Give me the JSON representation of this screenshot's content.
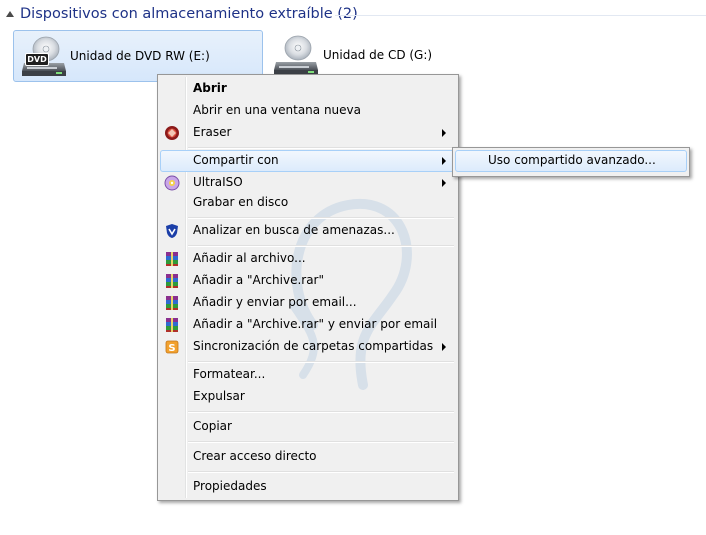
{
  "group": {
    "title": "Dispositivos con almacenamiento extraíble (2)"
  },
  "drives": [
    {
      "label": "Unidad de DVD RW (E:)",
      "icon": "dvd-drive-icon",
      "badge": "DVD",
      "selected": true
    },
    {
      "label": "Unidad de CD (G:)",
      "icon": "cd-drive-icon",
      "selected": false
    }
  ],
  "menu": {
    "items": [
      {
        "label": "Abrir",
        "bold": true
      },
      {
        "label": "Abrir en una ventana nueva"
      },
      {
        "label": "Eraser",
        "icon": "eraser-icon",
        "submenu": true
      },
      {
        "label": "Compartir con",
        "submenu": true,
        "highlighted": true
      },
      {
        "label": "UltraISO",
        "icon": "ultraiso-icon",
        "submenu": true
      },
      {
        "label": "Grabar en disco"
      },
      {
        "label": "Analizar en busca de amenazas...",
        "icon": "shield-icon"
      },
      {
        "label": "Añadir al archivo...",
        "icon": "winrar-icon"
      },
      {
        "label": "Añadir a \"Archive.rar\"",
        "icon": "winrar-icon"
      },
      {
        "label": "Añadir y enviar por email...",
        "icon": "winrar-icon"
      },
      {
        "label": "Añadir a \"Archive.rar\" y enviar por email",
        "icon": "winrar-icon"
      },
      {
        "label": "Sincronización de carpetas compartidas",
        "icon": "sync-icon",
        "submenu": true
      },
      {
        "label": "Formatear..."
      },
      {
        "label": "Expulsar"
      },
      {
        "label": "Copiar"
      },
      {
        "label": "Crear acceso directo"
      },
      {
        "label": "Propiedades"
      }
    ]
  },
  "submenu": {
    "items": [
      {
        "label": "Uso compartido avanzado...",
        "highlighted": true
      }
    ]
  },
  "colors": {
    "group_title": "#1e3287",
    "menu_background": "#f0f0f0",
    "highlight_border": "#a8d0f8",
    "selection_background": "#d6e7fb"
  }
}
